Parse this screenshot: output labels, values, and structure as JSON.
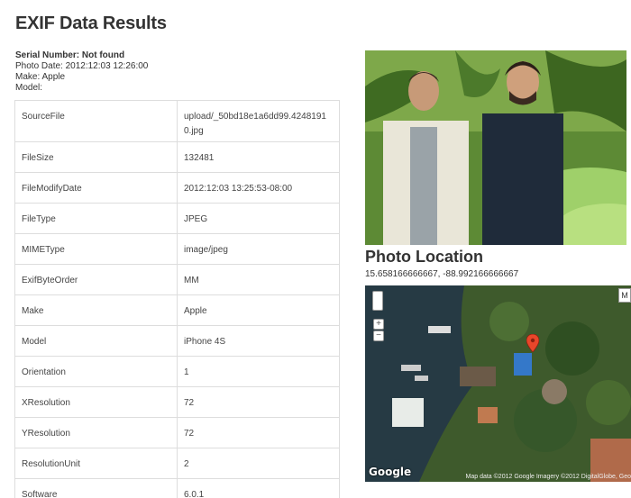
{
  "header": {
    "title": "EXIF Data Results"
  },
  "meta": {
    "serial": "Serial Number: Not found",
    "photo_date": "Photo Date: 2012:12:03 12:26:00",
    "make": "Make: Apple",
    "model": "Model:"
  },
  "exif_rows": [
    {
      "key": "SourceFile",
      "value": "upload/_50bd18e1a6dd99.42481910.jpg"
    },
    {
      "key": "FileSize",
      "value": "132481"
    },
    {
      "key": "FileModifyDate",
      "value": "2012:12:03 13:25:53-08:00"
    },
    {
      "key": "FileType",
      "value": "JPEG"
    },
    {
      "key": "MIMEType",
      "value": "image/jpeg"
    },
    {
      "key": "ExifByteOrder",
      "value": "MM"
    },
    {
      "key": "Make",
      "value": "Apple"
    },
    {
      "key": "Model",
      "value": "iPhone 4S"
    },
    {
      "key": "Orientation",
      "value": "1"
    },
    {
      "key": "XResolution",
      "value": "72"
    },
    {
      "key": "YResolution",
      "value": "72"
    },
    {
      "key": "ResolutionUnit",
      "value": "2"
    },
    {
      "key": "Software",
      "value": "6.0.1"
    }
  ],
  "location": {
    "title": "Photo Location",
    "coords": "15.658166666667, -88.992166666667"
  },
  "map": {
    "attribution": "Map data ©2012 Google Imagery ©2012 DigitalGlobe, Geo",
    "logo": "Google",
    "type_label": "M",
    "zoom_in": "+",
    "zoom_out": "−",
    "marker_color": "#e8462a"
  }
}
